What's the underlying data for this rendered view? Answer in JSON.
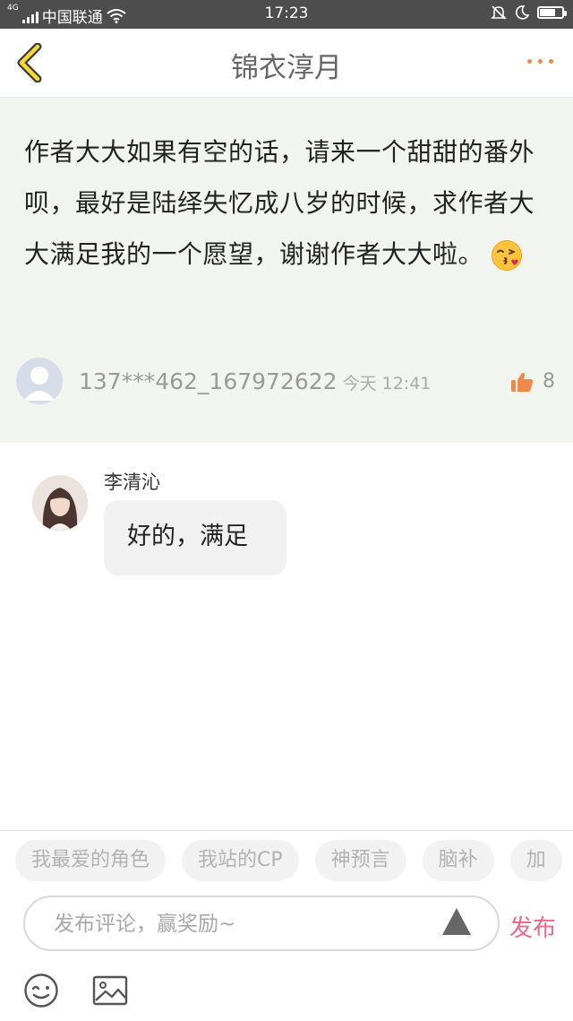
{
  "status_bar": {
    "network": "4G",
    "carrier": "中国联通",
    "time": "17:23"
  },
  "header": {
    "title": "锦衣淳月"
  },
  "comment": {
    "text": "作者大大如果有空的话，请来一个甜甜的番外呗，最好是陆绎失忆成八岁的时候，求作者大大满足我的一个愿望，谢谢作者大大啦。",
    "author": "137***462_167972622",
    "time": "今天 12:41",
    "likes": "8"
  },
  "reply": {
    "author": "李清沁",
    "text": "好的，满足"
  },
  "tags": [
    "我最爱的角色",
    "我站的CP",
    "神预言",
    "脑补",
    "加"
  ],
  "composer": {
    "placeholder": "发布评论，赢奖励~",
    "send_label": "发布"
  },
  "colors": {
    "accent_orange": "#f08a4b",
    "send_pink": "#e8698a",
    "card_bg": "#f2f4ef"
  }
}
